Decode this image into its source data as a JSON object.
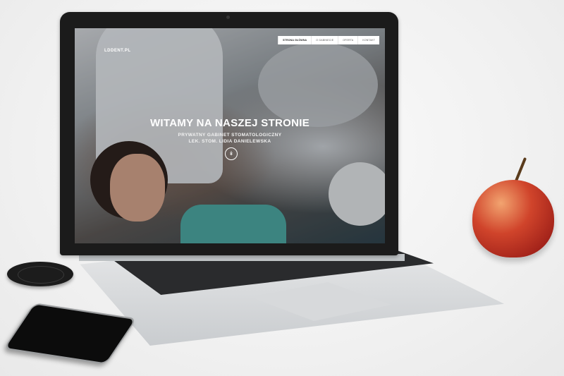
{
  "site": {
    "logo": "LDDENT.PL",
    "nav": [
      "STRONA GŁÓWNA",
      "O GABINECIE",
      "OFERTA",
      "KONTAKT"
    ],
    "active_nav": "STRONA GŁÓWNA",
    "hero_title": "WITAMY NA NASZEJ STRONIE",
    "hero_subtitle_line1": "PRYWATNY GABINET STOMATOLOGICZNY",
    "hero_subtitle_line2": "LEK. STOM. LIDIA DANIELEWSKA",
    "scroll_icon": "chevron-double-down-icon"
  },
  "colors": {
    "nav_bg": "#ffffff",
    "hero_text": "#ffffff",
    "apple_red": "#c63a26"
  }
}
